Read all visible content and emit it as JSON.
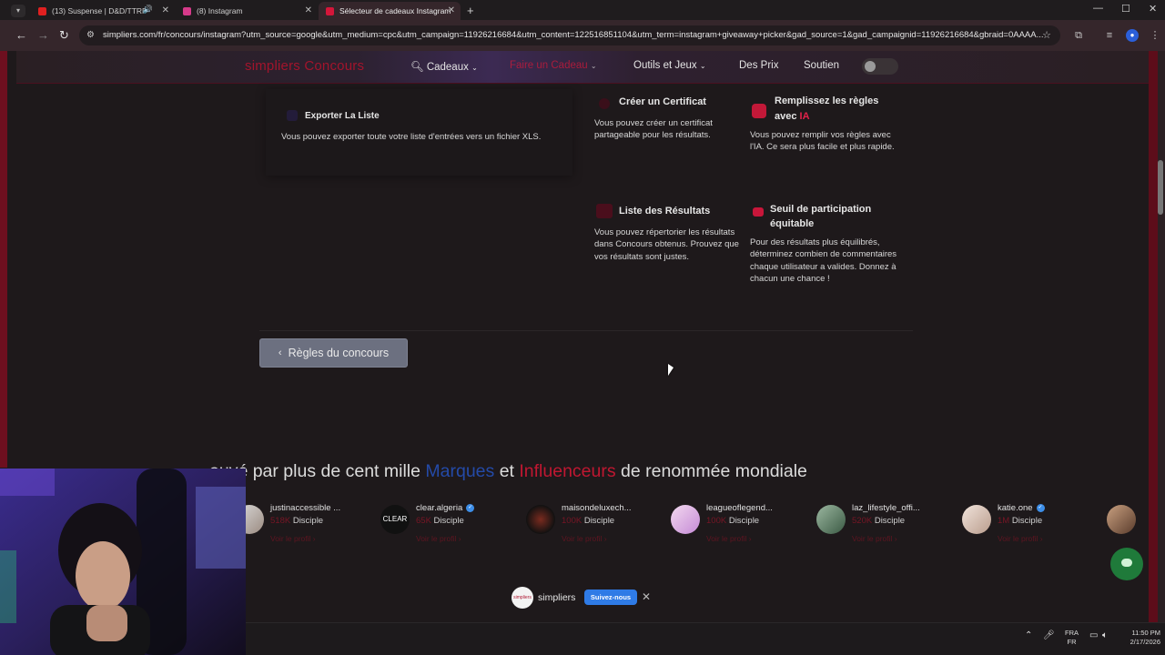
{
  "browser": {
    "tabs": [
      {
        "title": "(13) Suspense | D&D/TTRP",
        "favicon_color": "#e02020",
        "active": false
      },
      {
        "title": "(8) Instagram",
        "favicon_color": "#d63a8a",
        "active": false
      },
      {
        "title": "Sélecteur de cadeaux Instagram",
        "favicon_color": "#d5163a",
        "active": true
      }
    ],
    "address": "simpliers.com/fr/concours/instagram?utm_source=google&utm_medium=cpc&utm_campaign=11926216684&utm_content=122516851104&utm_term=instagram+giveaway+picker&gad_source=1&gad_campaignid=11926216684&gbraid=0AAAA..."
  },
  "site_nav": {
    "logo_part1": "simpliers",
    "logo_part2": "Concours",
    "items": [
      "Cadeaux",
      "Faire un Cadeau",
      "Outils et Jeux",
      "Des Prix",
      "Soutien"
    ]
  },
  "features": {
    "export": {
      "title": "Exporter La Liste",
      "text": "Vous pouvez exporter toute votre liste d'entrées vers un fichier XLS."
    },
    "certificate": {
      "title": "Créer un Certificat",
      "text": "Vous pouvez créer un certificat partageable pour les résultats."
    },
    "ai_rules": {
      "title": "Remplissez les règles avec",
      "title_highlight": "IA",
      "text": "Vous pouvez remplir vos règles avec l'IA. Ce sera plus facile et plus rapide."
    },
    "results": {
      "title": "Liste des Résultats",
      "text": "Vous pouvez répertorier les résultats dans Concours obtenus. Prouvez que vos résultats sont justes."
    },
    "threshold": {
      "title": "Seuil de participation équitable",
      "text": "Pour des résultats plus équilibrés, déterminez combien de commentaires chaque utilisateur a valides. Donnez à chacun une chance !"
    }
  },
  "rules_button": "Règles du concours",
  "trust": {
    "prefix": "ouvé par plus de cent mille",
    "brands": "Marques",
    "and": "et",
    "influencers": "Influenceurs",
    "suffix": "de renommée mondiale"
  },
  "influencers": [
    {
      "name": "justinaccessible ...",
      "count": "518K",
      "role": "Disciple",
      "link": "Voir le profil",
      "verified": false
    },
    {
      "name": "clear.algeria",
      "count": "65K",
      "role": "Disciple",
      "link": "Voir le profil",
      "verified": true
    },
    {
      "name": "maisondeluxech...",
      "count": "100K",
      "role": "Disciple",
      "link": "Voir le profil",
      "verified": false
    },
    {
      "name": "leagueoflegend...",
      "count": "100K",
      "role": "Disciple",
      "link": "Voir le profil",
      "verified": false
    },
    {
      "name": "laz_lifestyle_offi...",
      "count": "520K",
      "role": "Disciple",
      "link": "Voir le profil",
      "verified": false
    },
    {
      "name": "katie.one",
      "count": "1M",
      "role": "Disciple",
      "link": "Voir le profil",
      "verified": true
    }
  ],
  "follow_bar": {
    "name": "simpliers",
    "button": "Suivez-nous"
  },
  "taskbar": {
    "lang_line1": "FRA",
    "lang_line2": "FR",
    "time": "11:50 PM",
    "date": "2/17/2026"
  }
}
